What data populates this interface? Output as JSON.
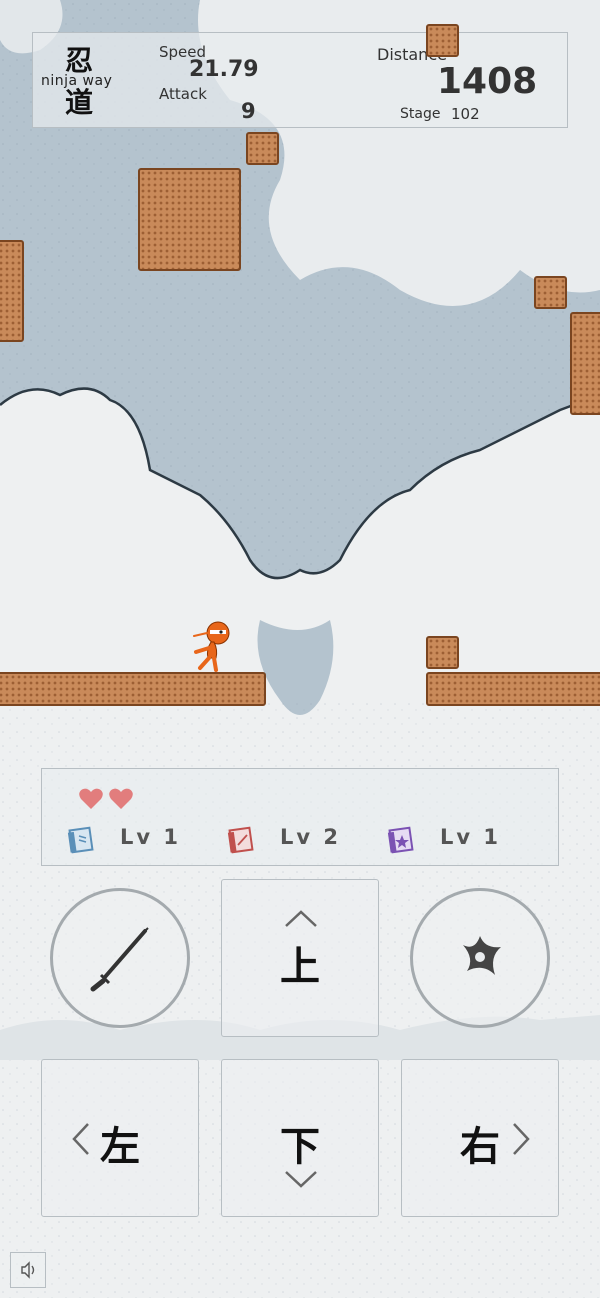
{
  "hud": {
    "logo_kanji_top": "忍",
    "logo_kanji_bottom": "道",
    "logo_text": "ninja way",
    "speed_label": "Speed",
    "speed_value": "21.79",
    "attack_label": "Attack",
    "attack_value": "9",
    "distance_label": "Distance",
    "distance_value": "1408",
    "stage_label": "Stage",
    "stage_value": "102"
  },
  "status": {
    "hearts": 2,
    "items": [
      {
        "icon": "blue-scroll-icon",
        "label": "Lv 1",
        "color": "#5a8fb8"
      },
      {
        "icon": "red-scroll-icon",
        "label": "Lv 2",
        "color": "#c0504d"
      },
      {
        "icon": "purple-scroll-icon",
        "label": "Lv 1",
        "color": "#7b52b3"
      }
    ]
  },
  "controls": {
    "up": "上",
    "down": "下",
    "left": "左",
    "right": "右",
    "sword": "sword-icon",
    "shuriken": "shuriken-icon",
    "sound": "speaker-icon"
  },
  "colors": {
    "brick": "#c98a5a",
    "brick_border": "#7a4520",
    "player": "#e8661a",
    "heart": "#e27d7d"
  }
}
